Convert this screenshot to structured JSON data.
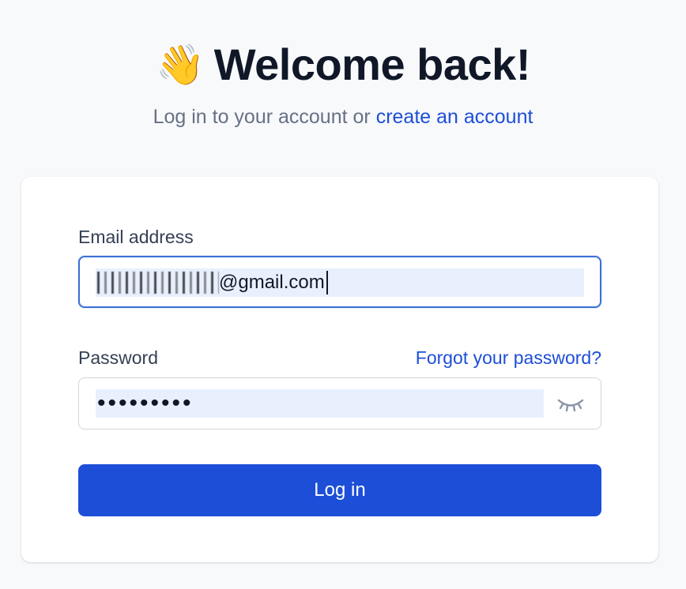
{
  "header": {
    "wave_emoji": "👋",
    "title": "Welcome back!",
    "subtitle_prefix": "Log in to your account or ",
    "create_account_link": "create an account"
  },
  "form": {
    "email": {
      "label": "Email address",
      "value_visible_suffix": "@gmail.com",
      "redacted_prefix": true
    },
    "password": {
      "label": "Password",
      "forgot_link": "Forgot your password?",
      "masked_value": "•••••••••",
      "toggle_icon": "eye-closed-icon"
    },
    "submit_label": "Log in"
  },
  "colors": {
    "accent": "#1d4ed8",
    "focus_border": "#3b6fd6",
    "autofill_bg": "#e8f0fe",
    "page_bg": "#f8f9fb"
  }
}
